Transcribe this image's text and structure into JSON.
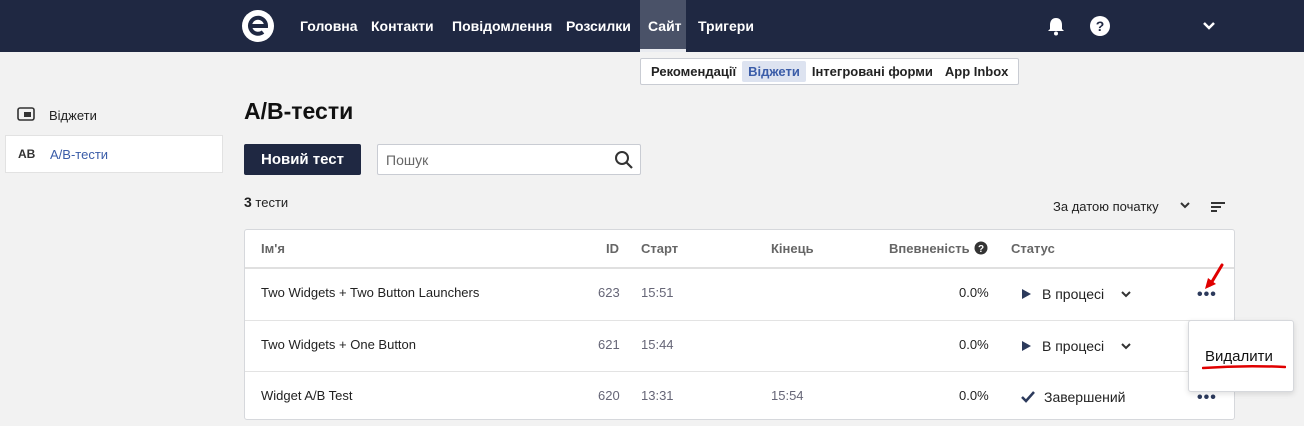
{
  "nav": {
    "items": [
      "Головна",
      "Контакти",
      "Повідомлення",
      "Розсилки",
      "Сайт",
      "Тригери"
    ],
    "active": "Сайт"
  },
  "subnav": {
    "items": [
      "Рекомендації",
      "Віджети",
      "Інтегровані форми",
      "App Inbox"
    ],
    "active": "Віджети"
  },
  "sidebar": {
    "items": [
      {
        "icon": "widget-icon",
        "label": "Віджети"
      },
      {
        "icon_text": "AB",
        "label": "A/B-тести"
      }
    ]
  },
  "page": {
    "title": "A/B-тести",
    "new_button": "Новий тест",
    "search_placeholder": "Пошук",
    "count": "3",
    "count_suffix": "тести",
    "sort_label": "За датою початку"
  },
  "table": {
    "headers": [
      "Ім'я",
      "ID",
      "Старт",
      "Кінець",
      "Впевненість",
      "Статус"
    ],
    "rows": [
      {
        "name": "Two Widgets + Two Button Launchers",
        "id": "623",
        "start": "15:51",
        "end": "",
        "confidence": "0.0%",
        "status": "В процесі",
        "status_icon": "play-icon"
      },
      {
        "name": "Two Widgets + One Button",
        "id": "621",
        "start": "15:44",
        "end": "",
        "confidence": "0.0%",
        "status": "В процесі",
        "status_icon": "play-icon"
      },
      {
        "name": "Widget A/B Test",
        "id": "620",
        "start": "13:31",
        "end": "15:54",
        "confidence": "0.0%",
        "status": "Завершений",
        "status_icon": "check-icon"
      }
    ]
  },
  "popup": {
    "delete_label": "Видалити"
  },
  "colors": {
    "nav_bg": "#1f2842",
    "accent": "#3a5ca8",
    "annotation": "#e00000"
  }
}
